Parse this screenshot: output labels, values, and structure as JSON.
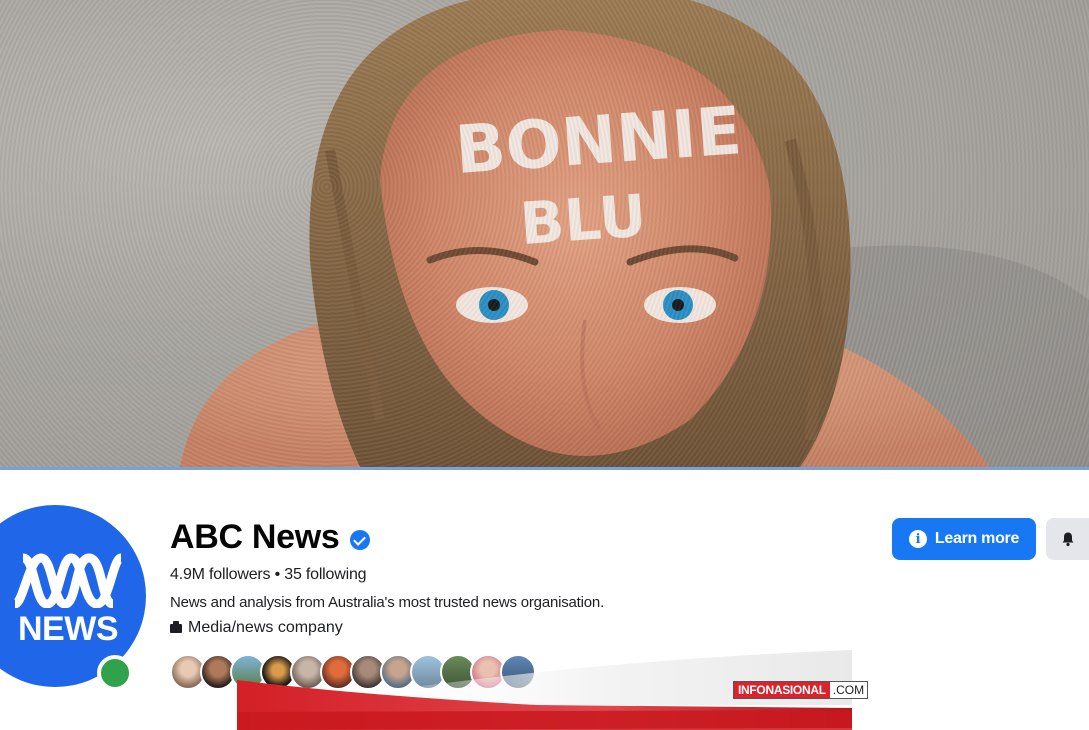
{
  "cover": {
    "forehead_text_line1": "BONNIE",
    "forehead_text_line2": "BLU"
  },
  "profile": {
    "avatar_text": "NEWS",
    "name": "ABC News",
    "stats": "4.9M followers • 35 following",
    "bio": "News and analysis from Australia's most trusted news organisation.",
    "category": "Media/news company",
    "follower_avatar_count": 12
  },
  "actions": {
    "learn_more_label": "Learn more"
  },
  "watermark": {
    "brand": "INFONASIONAL",
    "tld": ".COM"
  },
  "colors": {
    "brand_blue": "#1877f2",
    "avatar_blue": "#1f66e8",
    "online_green": "#31a24c",
    "watermark_red": "#d9232d"
  },
  "icons": {
    "verified": "verified-badge-icon",
    "info": "info-icon",
    "bell": "bell-icon",
    "category": "briefcase-icon"
  }
}
